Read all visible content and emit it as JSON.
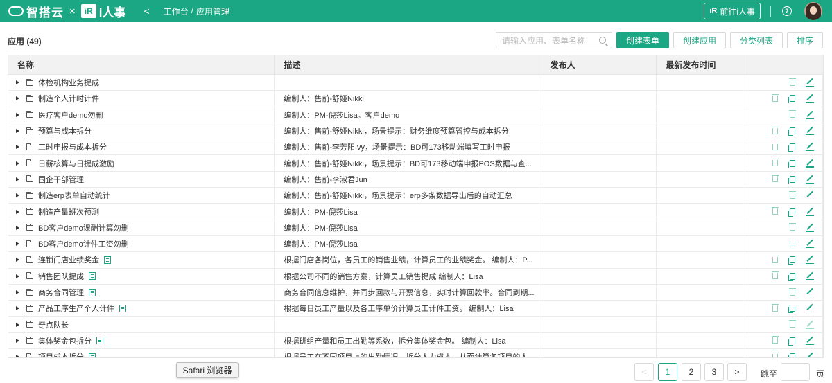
{
  "header": {
    "brand_name": "智搭云",
    "times": "×",
    "partner_ir": "iR",
    "partner_name": "i人事",
    "back_glyph": "<",
    "breadcrumb": [
      "工作台",
      "/",
      "应用管理"
    ],
    "goto_button": {
      "icon_text": "iR",
      "label": "前往i人事"
    },
    "help_glyph": "?"
  },
  "toolbar": {
    "title": "应用 (49)",
    "search_placeholder": "请输入应用、表单名称",
    "buttons": [
      "创建表单",
      "创建应用",
      "分类列表",
      "排序"
    ]
  },
  "table": {
    "headers": [
      "名称",
      "描述",
      "发布人",
      "最新发布时间",
      ""
    ],
    "rows": [
      {
        "name": "体检机构业务提成",
        "desc": "",
        "form": false,
        "actions": "trash-edit"
      },
      {
        "name": "制造个人计时计件",
        "desc": "编制人：售前-舒娅Nikki",
        "form": false,
        "actions": "all"
      },
      {
        "name": "医疗客户demo勿删",
        "desc": "编制人：PM-倪莎Lisa。客户demo",
        "form": false,
        "actions": "trash-edit"
      },
      {
        "name": "预算与成本拆分",
        "desc": "编制人：售前-舒娅Nikki，场景提示：财务维度预算管控与成本拆分",
        "form": false,
        "actions": "all"
      },
      {
        "name": "工时申报与成本拆分",
        "desc": "编制人：售前-李芳阳Ivy，场景提示：BD可173移动端填写工时申报",
        "form": false,
        "actions": "all"
      },
      {
        "name": "日薪核算与日提成激励",
        "desc": "编制人：售前-舒娅Nikki，场景提示：BD可173移动端申报POS数据与查...",
        "form": false,
        "actions": "all"
      },
      {
        "name": "国企干部管理",
        "desc": "编制人：售前-李淑君Jun",
        "form": false,
        "actions": "all"
      },
      {
        "name": "制造erp表单自动统计",
        "desc": "编制人：售前-舒娅Nikki，场景提示：erp多条数据导出后的自动汇总",
        "form": false,
        "actions": "trash-edit"
      },
      {
        "name": "制造产量班次预测",
        "desc": "编制人：PM-倪莎Lisa",
        "form": false,
        "actions": "all"
      },
      {
        "name": "BD客户demo课酬计算勿删",
        "desc": "编制人：PM-倪莎Lisa",
        "form": false,
        "actions": "trash-edit"
      },
      {
        "name": "BD客户demo计件工资勿删",
        "desc": "编制人：PM-倪莎Lisa",
        "form": false,
        "actions": "trash-edit"
      },
      {
        "name": "连锁门店业绩奖金",
        "desc": "根据门店各岗位，各员工的销售业绩，计算员工的业绩奖金。 编制人：P...",
        "form": true,
        "actions": "all"
      },
      {
        "name": "销售团队提成",
        "desc": "根据公司不同的销售方案，计算员工销售提成 编制人：Lisa",
        "form": true,
        "actions": "all"
      },
      {
        "name": "商务合同管理",
        "desc": "商务合同信息维护，并同步回款与开票信息，实时计算回款率。合同到期...",
        "form": true,
        "actions": "trash-edit"
      },
      {
        "name": "产品工序生产个人计件",
        "desc": "根据每日员工产量以及各工序单价计算员工计件工资。 编制人：Lisa",
        "form": true,
        "actions": "all"
      },
      {
        "name": "奇点队长",
        "desc": "",
        "form": false,
        "actions": "trash-edit-light"
      },
      {
        "name": "集体奖金包拆分",
        "desc": "根据班组产量和员工出勤等系数，拆分集体奖金包。 编制人：Lisa",
        "form": true,
        "actions": "all"
      },
      {
        "name": "项目成本拆分",
        "desc": "根据员工在不同项目上的出勤情况，拆分人力成本，从而计算各项目的人...",
        "form": true,
        "actions": "all"
      }
    ]
  },
  "tooltip": "Safari 浏览器",
  "pagination": {
    "prev": "<",
    "pages": [
      "1",
      "2",
      "3"
    ],
    "current": "1",
    "next": ">",
    "jump_label": "跳至",
    "page_unit": "页"
  },
  "colors": {
    "accent": "#1ba784",
    "header_bg": "#1ba784"
  }
}
